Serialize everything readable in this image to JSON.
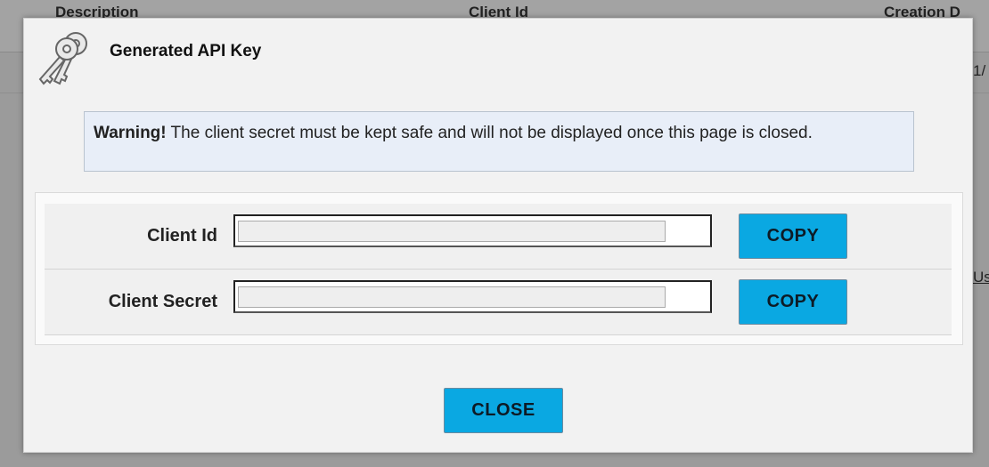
{
  "background": {
    "columns": [
      "Description",
      "Client Id",
      "Creation D"
    ],
    "row_fragment": "1/",
    "link_fragment": "Us"
  },
  "dialog": {
    "icon": "keys-icon",
    "title": "Generated API Key",
    "warning": {
      "strong": "Warning!",
      "text": " The client secret must be kept safe and will not be displayed once this page is closed."
    },
    "fields": [
      {
        "label": "Client Id",
        "value": "",
        "copy_label": "COPY"
      },
      {
        "label": "Client Secret",
        "value": "",
        "copy_label": "COPY"
      }
    ],
    "close_label": "CLOSE"
  },
  "colors": {
    "button": "#0aa8e2",
    "warning_bg": "#e8eef8",
    "overlay": "#9b9b9b"
  }
}
